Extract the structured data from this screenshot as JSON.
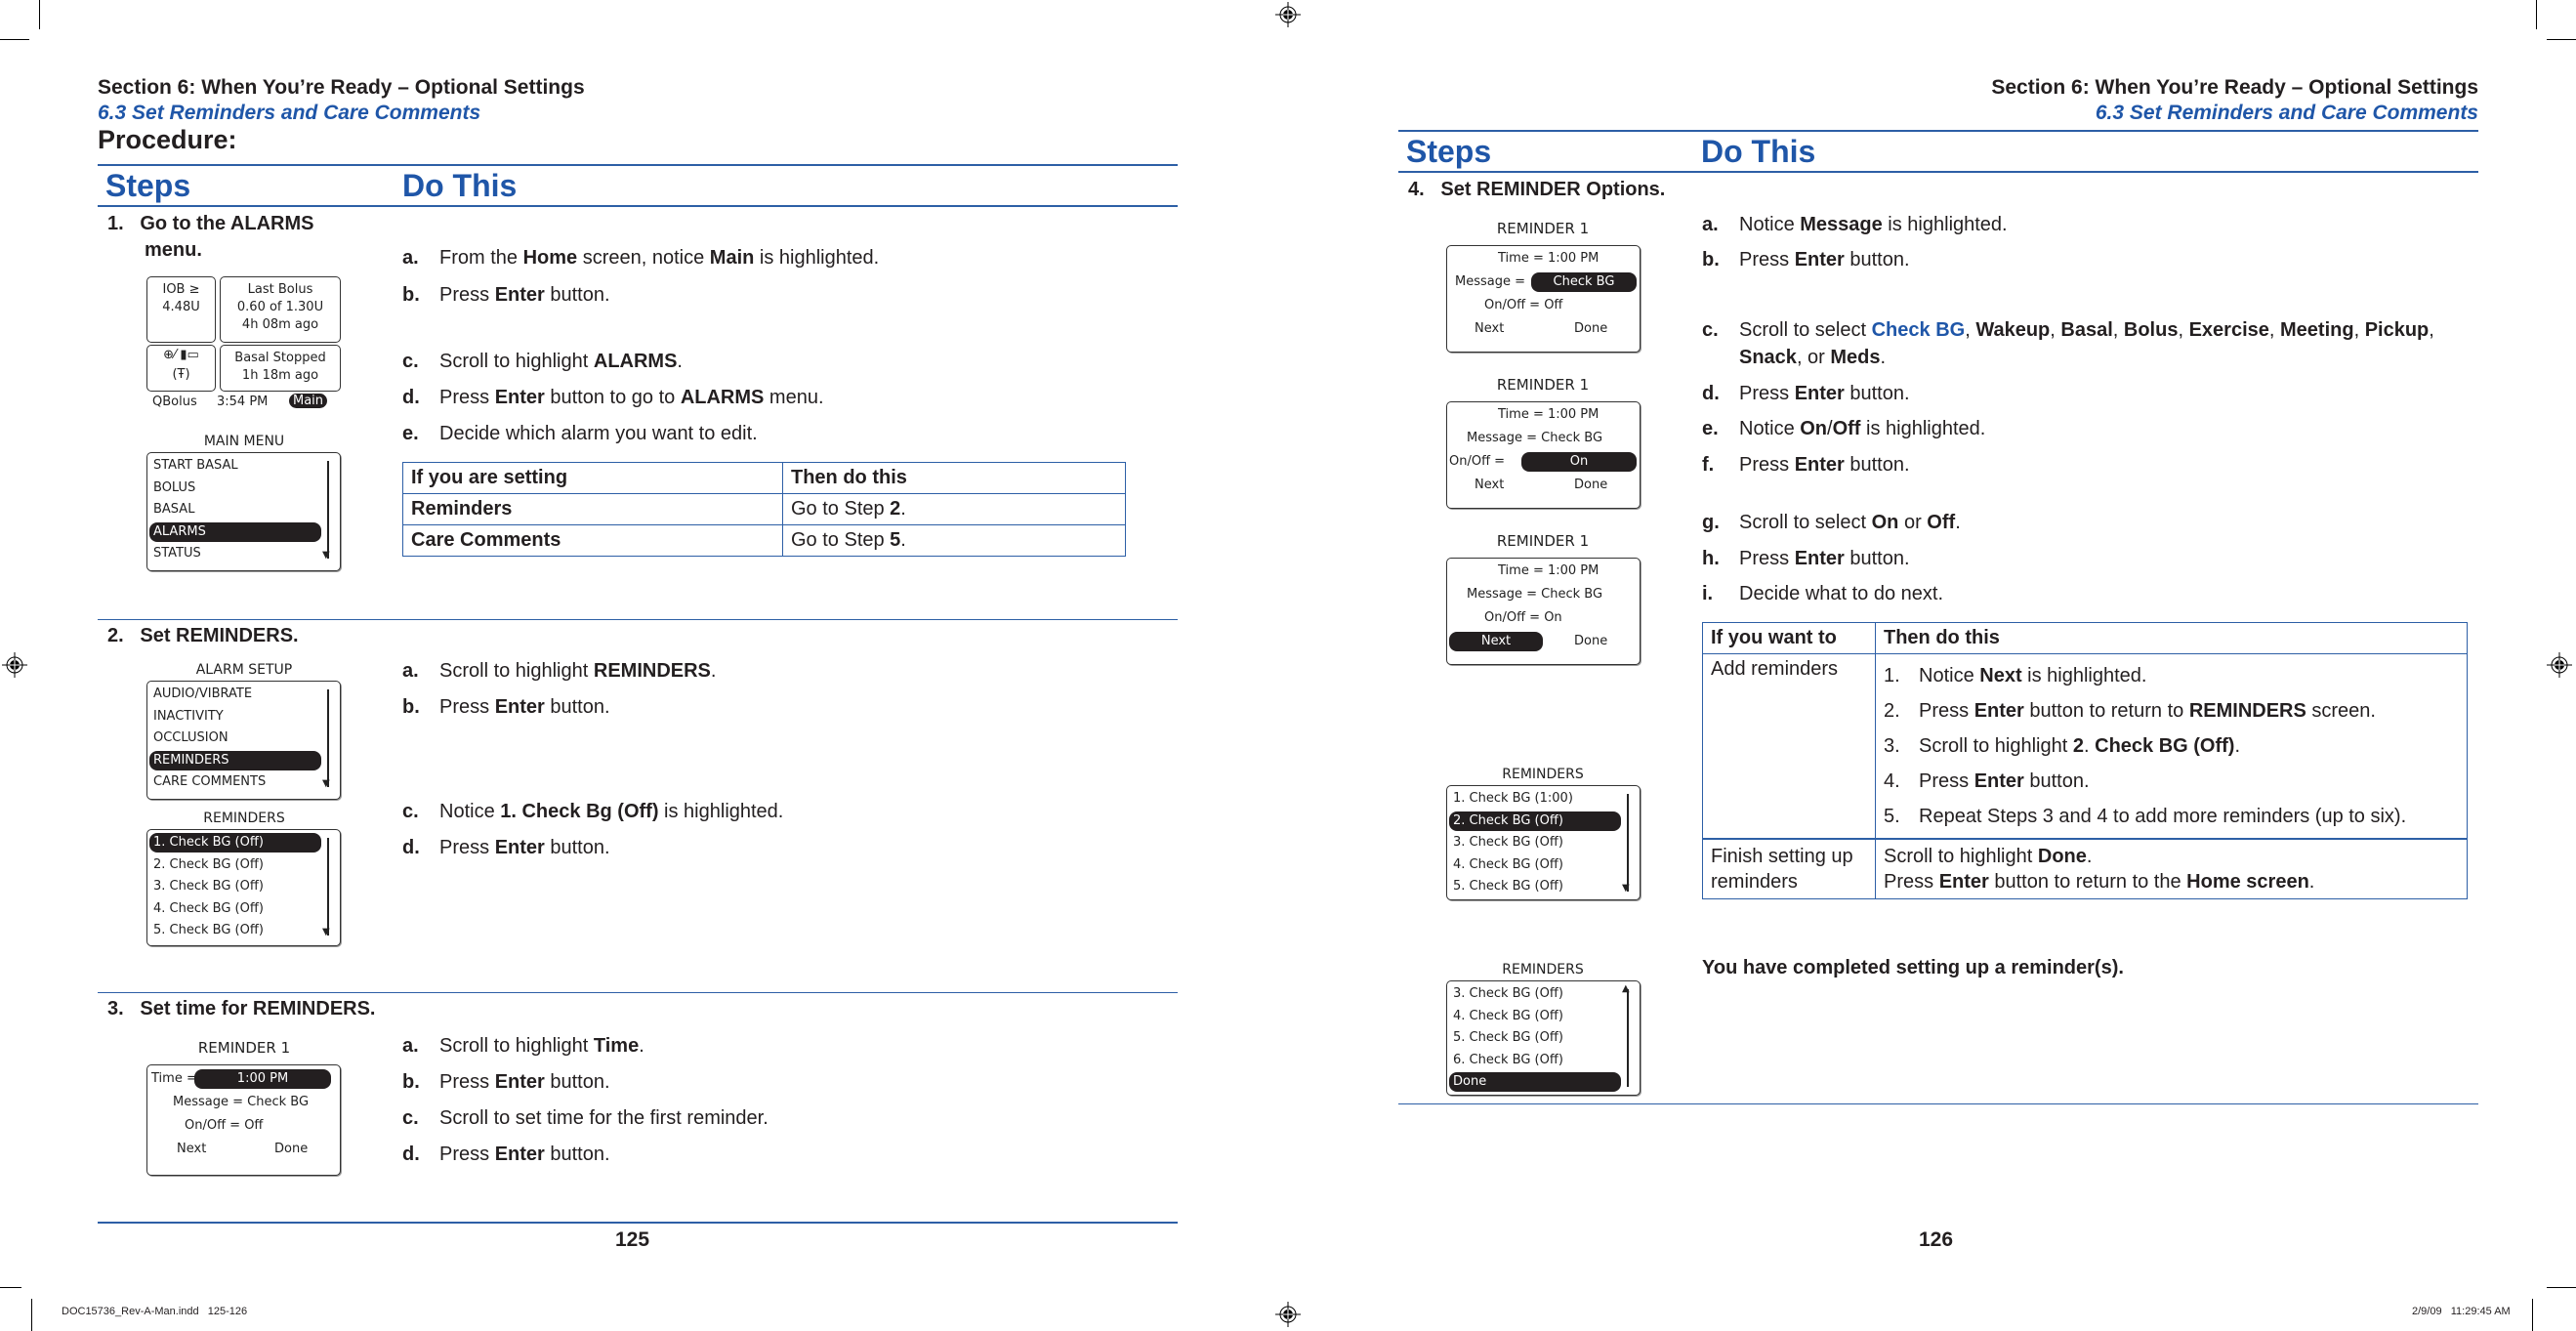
{
  "left_page": {
    "section_title": "Section 6: When You’re Ready – Optional Settings",
    "subsection_title": "6.3 Set Reminders and Care Comments",
    "procedure_label": "Procedure:",
    "col_steps": "Steps",
    "col_do_this": "Do This",
    "page_number": "125",
    "step1": {
      "title_line1": "1.   Go to the ALARMS",
      "title_line2": "menu.",
      "home_screen": {
        "iob_line1": "IOB ≥",
        "iob_line2": "4.48U",
        "last_bolus_line1": "Last Bolus",
        "last_bolus_line2": "0.60 of 1.30U",
        "last_bolus_line3": "4h 08m ago",
        "basal_line1": "Basal Stopped",
        "basal_line2": "1h 18m ago",
        "status_icons": "⊕⁄ ▮▭",
        "antenna_icon": "(Ŧ)",
        "left_softkey": "QBolus",
        "time": "3:54 PM",
        "right_softkey": "Main"
      },
      "main_menu": {
        "title": "MAIN MENU",
        "items": [
          "START BASAL",
          "BOLUS",
          "BASAL",
          "ALARMS",
          "STATUS"
        ],
        "highlighted_index": 3
      },
      "instructions": [
        {
          "letter": "a.",
          "parts": [
            [
              "From the ",
              false
            ],
            [
              "Home",
              true
            ],
            [
              " screen, notice ",
              false
            ],
            [
              "Main",
              true
            ],
            [
              " is highlighted.",
              false
            ]
          ]
        },
        {
          "letter": "b.",
          "parts": [
            [
              "Press ",
              false
            ],
            [
              "Enter",
              true
            ],
            [
              " button.",
              false
            ]
          ]
        },
        {
          "letter": "c.",
          "parts": [
            [
              "Scroll to highlight ",
              false
            ],
            [
              "ALARMS",
              true
            ],
            [
              ".",
              false
            ]
          ]
        },
        {
          "letter": "d.",
          "parts": [
            [
              "Press ",
              false
            ],
            [
              "Enter",
              true
            ],
            [
              " button to go to ",
              false
            ],
            [
              "ALARMS",
              true
            ],
            [
              " menu.",
              false
            ]
          ]
        },
        {
          "letter": "e.",
          "parts": [
            [
              "Decide which alarm you want to edit.",
              false
            ]
          ]
        }
      ],
      "table": {
        "headers": [
          "If you are setting",
          "Then do this"
        ],
        "rows": [
          {
            "setting": "Reminders",
            "action_prefix": "Go to Step ",
            "action_step": "2",
            "action_suffix": "."
          },
          {
            "setting": "Care Comments",
            "action_prefix": "Go to Step ",
            "action_step": "5",
            "action_suffix": "."
          }
        ]
      }
    },
    "step2": {
      "title": "2.   Set REMINDERS.",
      "alarm_setup": {
        "title": "ALARM SETUP",
        "items": [
          "AUDIO/VIBRATE",
          "INACTIVITY",
          "OCCLUSION",
          "REMINDERS",
          "CARE COMMENTS"
        ],
        "highlighted_index": 3
      },
      "reminders": {
        "title": "REMINDERS",
        "items": [
          "1. Check BG (Off)",
          "2. Check BG (Off)",
          "3. Check BG (Off)",
          "4. Check BG (Off)",
          "5. Check BG (Off)"
        ],
        "highlighted_index": 0
      },
      "instructions": [
        {
          "letter": "a.",
          "parts": [
            [
              "Scroll to highlight ",
              false
            ],
            [
              "REMINDERS",
              true
            ],
            [
              ".",
              false
            ]
          ]
        },
        {
          "letter": "b.",
          "parts": [
            [
              "Press ",
              false
            ],
            [
              "Enter",
              true
            ],
            [
              " button.",
              false
            ]
          ]
        },
        {
          "letter": "c.",
          "parts": [
            [
              "Notice ",
              false
            ],
            [
              "1. Check Bg (Off)",
              true
            ],
            [
              " is highlighted.",
              false
            ]
          ]
        },
        {
          "letter": "d.",
          "parts": [
            [
              "Press ",
              false
            ],
            [
              "Enter",
              true
            ],
            [
              " button.",
              false
            ]
          ]
        }
      ]
    },
    "step3": {
      "title": "3.   Set time for REMINDERS.",
      "screen": {
        "title": "REMINDER 1",
        "time_label": "Time =",
        "time_value": "1:00 PM",
        "message": "Message = Check BG",
        "onoff": "On/Off = Off",
        "next": "Next",
        "done": "Done"
      },
      "instructions": [
        {
          "letter": "a.",
          "parts": [
            [
              "Scroll to highlight ",
              false
            ],
            [
              "Time",
              true
            ],
            [
              ".",
              false
            ]
          ]
        },
        {
          "letter": "b.",
          "parts": [
            [
              "Press ",
              false
            ],
            [
              "Enter",
              true
            ],
            [
              " button.",
              false
            ]
          ]
        },
        {
          "letter": "c.",
          "parts": [
            [
              "Scroll to set time for the first reminder.",
              false
            ]
          ]
        },
        {
          "letter": "d.",
          "parts": [
            [
              "Press ",
              false
            ],
            [
              "Enter",
              true
            ],
            [
              " button.",
              false
            ]
          ]
        }
      ]
    }
  },
  "right_page": {
    "section_title": "Section 6: When You’re Ready – Optional Settings",
    "subsection_title": "6.3 Set Reminders and Care Comments",
    "col_steps": "Steps",
    "col_do_this": "Do This",
    "page_number": "126",
    "step4": {
      "title": "4.   Set REMINDER Options.",
      "screens": [
        {
          "title": "REMINDER 1",
          "time": "Time = 1:00 PM",
          "message_label": "Message =",
          "message_value": "Check BG",
          "onoff": "On/Off = Off",
          "next": "Next",
          "done": "Done",
          "highlight": "message"
        },
        {
          "title": "REMINDER 1",
          "time": "Time = 1:00 PM",
          "message": "Message = Check BG",
          "onoff_label": "On/Off =",
          "onoff_value": "On",
          "next": "Next",
          "done": "Done",
          "highlight": "onoff"
        },
        {
          "title": "REMINDER 1",
          "time": "Time = 1:00 PM",
          "message": "Message = Check BG",
          "onoff": "On/Off = On",
          "next": "Next",
          "done": "Done",
          "highlight": "next"
        }
      ],
      "reminders_a": {
        "title": "REMINDERS",
        "items": [
          "1. Check BG (1:00)",
          "2. Check BG (Off)",
          "3. Check BG (Off)",
          "4. Check BG (Off)",
          "5. Check BG (Off)"
        ],
        "highlighted_index": 1
      },
      "reminders_b": {
        "title": "REMINDERS",
        "items": [
          "3. Check BG (Off)",
          "4. Check BG (Off)",
          "5. Check BG (Off)",
          "6. Check BG (Off)",
          "Done"
        ],
        "highlighted_index": 4
      },
      "instructions": [
        {
          "letter": "a.",
          "parts": [
            [
              "Notice ",
              false
            ],
            [
              "Message",
              true
            ],
            [
              " is highlighted.",
              false
            ]
          ]
        },
        {
          "letter": "b.",
          "parts": [
            [
              "Press ",
              false
            ],
            [
              "Enter",
              true
            ],
            [
              " button.",
              false
            ]
          ]
        },
        {
          "letter": "c.",
          "line1": [
            [
              "Scroll to select ",
              false
            ],
            [
              "Check BG",
              "blue"
            ],
            [
              ", ",
              false
            ],
            [
              "Wakeup",
              true
            ],
            [
              ", ",
              false
            ],
            [
              "Basal",
              true
            ],
            [
              ", ",
              false
            ],
            [
              "Bolus",
              true
            ],
            [
              ", ",
              false
            ],
            [
              "Exercise",
              true
            ],
            [
              ", ",
              false
            ],
            [
              "Meeting",
              true
            ],
            [
              ", ",
              false
            ],
            [
              "Pickup",
              true
            ],
            [
              ",",
              false
            ]
          ],
          "line2": [
            [
              "Snack",
              true
            ],
            [
              ", or ",
              false
            ],
            [
              "Meds",
              true
            ],
            [
              ".",
              false
            ]
          ]
        },
        {
          "letter": "d.",
          "parts": [
            [
              "Press ",
              false
            ],
            [
              "Enter",
              true
            ],
            [
              " button.",
              false
            ]
          ]
        },
        {
          "letter": "e.",
          "parts": [
            [
              "Notice ",
              false
            ],
            [
              "On",
              true
            ],
            [
              "/",
              false
            ],
            [
              "Off",
              true
            ],
            [
              " is highlighted.",
              false
            ]
          ]
        },
        {
          "letter": "f.",
          "parts": [
            [
              "Press ",
              false
            ],
            [
              "Enter",
              true
            ],
            [
              " button.",
              false
            ]
          ]
        },
        {
          "letter": "g.",
          "parts": [
            [
              "Scroll to select ",
              false
            ],
            [
              "On",
              true
            ],
            [
              " or ",
              false
            ],
            [
              "Off",
              true
            ],
            [
              ".",
              false
            ]
          ]
        },
        {
          "letter": "h.",
          "parts": [
            [
              "Press ",
              false
            ],
            [
              "Enter",
              true
            ],
            [
              " button.",
              false
            ]
          ]
        },
        {
          "letter": "i.",
          "parts": [
            [
              "Decide what to do next.",
              false
            ]
          ]
        }
      ],
      "table": {
        "headers": [
          "If you want to",
          "Then do this"
        ],
        "add_label": "Add reminders",
        "add_steps": [
          {
            "n": "1.",
            "parts": [
              [
                "Notice ",
                false
              ],
              [
                "Next",
                true
              ],
              [
                " is highlighted.",
                false
              ]
            ]
          },
          {
            "n": "2.",
            "parts": [
              [
                "Press ",
                false
              ],
              [
                "Enter",
                true
              ],
              [
                " button to return to ",
                false
              ],
              [
                "REMINDERS",
                true
              ],
              [
                " screen.",
                false
              ]
            ]
          },
          {
            "n": "3.",
            "parts": [
              [
                "Scroll to highlight ",
                false
              ],
              [
                "2",
                true
              ],
              [
                ". ",
                false
              ],
              [
                "Check BG (Off)",
                true
              ],
              [
                ".",
                false
              ]
            ]
          },
          {
            "n": "4.",
            "parts": [
              [
                "Press ",
                false
              ],
              [
                "Enter",
                true
              ],
              [
                " button.",
                false
              ]
            ]
          },
          {
            "n": "5.",
            "parts": [
              [
                "Repeat Steps 3 and 4 to add more reminders (up to six).",
                false
              ]
            ]
          }
        ],
        "finish_label_line1": "Finish setting up",
        "finish_label_line2": "reminders",
        "finish_line1": [
          [
            "Scroll to highlight ",
            false
          ],
          [
            "Done",
            true
          ],
          [
            ".",
            false
          ]
        ],
        "finish_line2": [
          [
            "Press ",
            false
          ],
          [
            "Enter",
            true
          ],
          [
            " button to return to the ",
            false
          ],
          [
            "Home screen",
            true
          ],
          [
            ".",
            false
          ]
        ]
      },
      "completion": "You have completed setting up a reminder(s)."
    }
  },
  "print_footer": {
    "file": "DOC15736_Rev-A-Man.indd   125-126",
    "timestamp": "2/9/09   11:29:45 AM"
  },
  "colors": {
    "accent_blue": "#1f56a8",
    "rule_blue": "#2d5fa6",
    "text": "#231f20"
  }
}
